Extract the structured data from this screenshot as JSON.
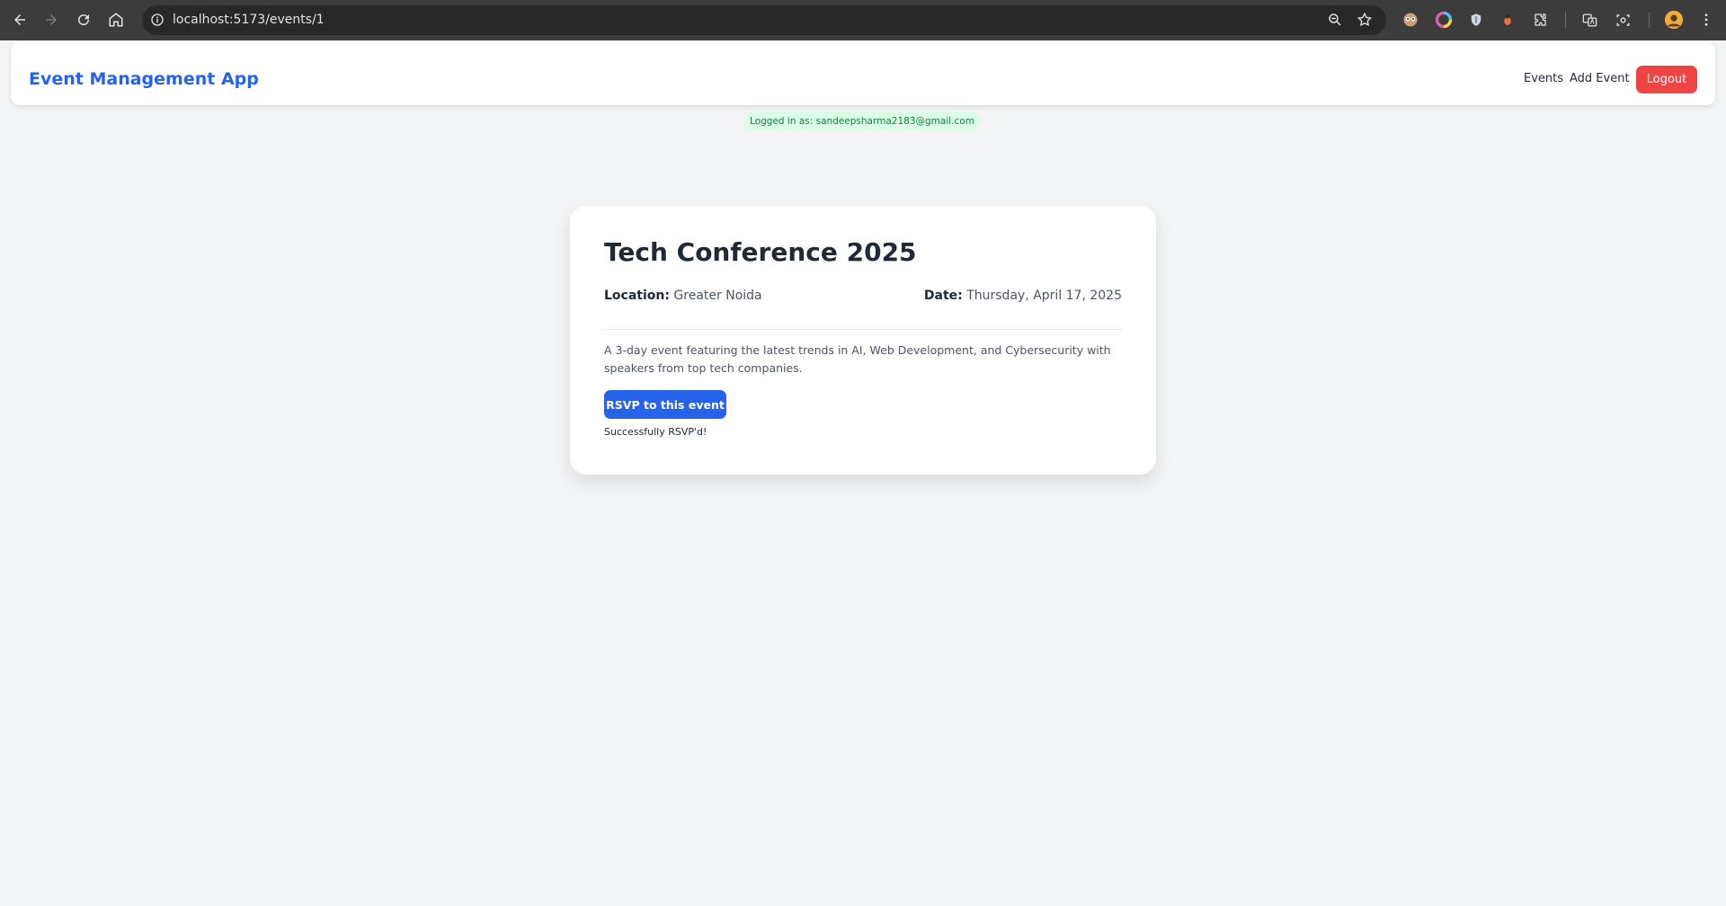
{
  "browser": {
    "url": "localhost:5173/events/1",
    "icons": [
      "back-icon",
      "forward-icon",
      "reload-icon",
      "home-icon",
      "site-info-icon",
      "zoom-icon",
      "bookmark-star-icon",
      "extension-eyes-icon",
      "extension-color-icon",
      "extension-shield-icon",
      "extension-bug-icon",
      "extensions-puzzle-icon",
      "translate-icon",
      "screenshot-icon",
      "profile-avatar-icon",
      "menu-kebab-icon"
    ]
  },
  "header": {
    "brand": "Event Management App",
    "nav": {
      "events": "Events",
      "add_event": "Add Event",
      "logout": "Logout"
    }
  },
  "session": {
    "logged_in": "Logged in as: sandeepsharma2183@gmail.com"
  },
  "event": {
    "title": "Tech Conference 2025",
    "location_label": "Location:",
    "location": "Greater Noida",
    "date_label": "Date:",
    "date": "Thursday, April 17, 2025",
    "description": "A 3-day event featuring the latest trends in AI, Web Development, and Cybersecurity with speakers from top tech companies.",
    "rsvp_button": "RSVP to this event",
    "status": "Successfully RSVP'd!"
  },
  "colors": {
    "brand": "#2563eb",
    "logout": "#ef4444",
    "badge_bg": "#dcfce7",
    "badge_text": "#15803d",
    "page_bg": "#f3f4f6"
  }
}
